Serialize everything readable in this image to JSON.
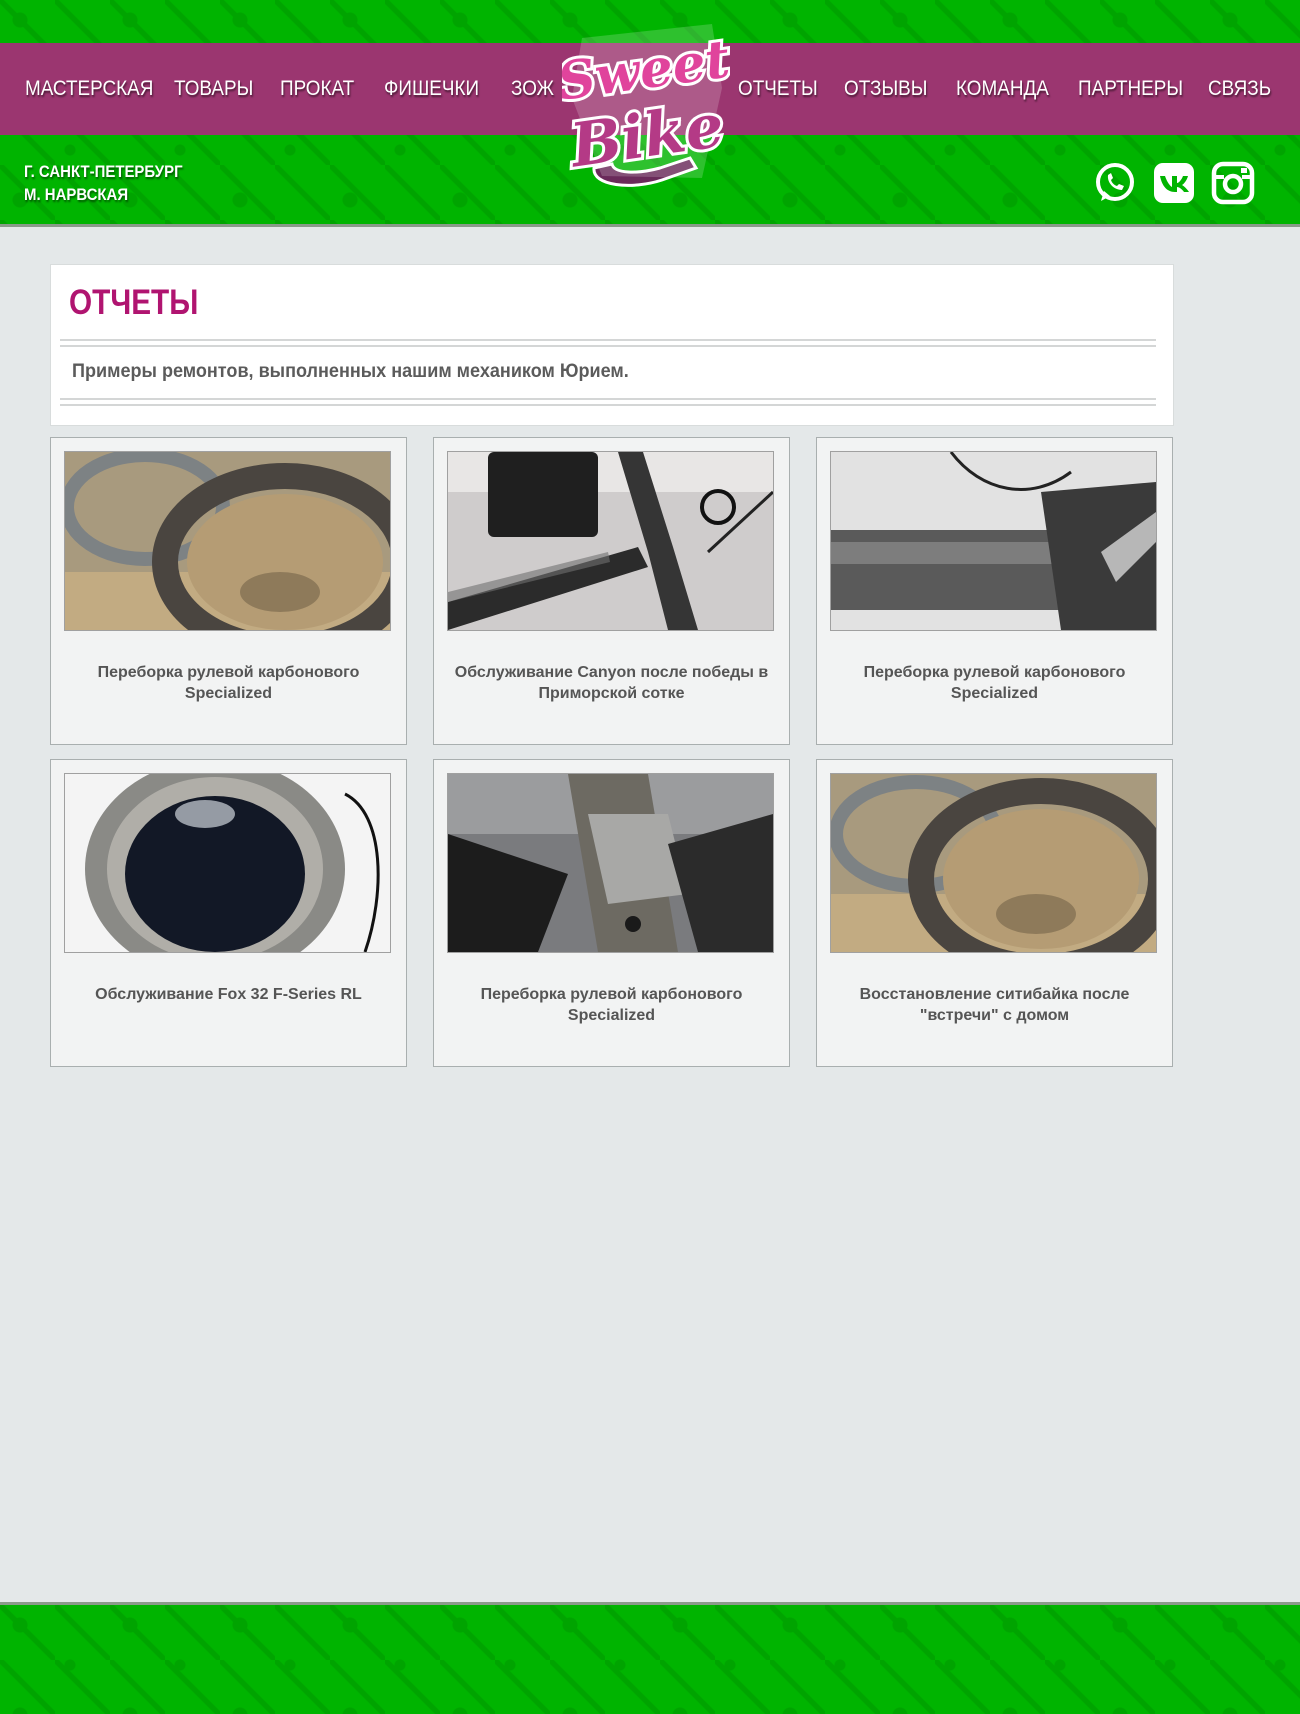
{
  "nav": {
    "left": [
      "МАСТЕРСКАЯ",
      "ТОВАРЫ",
      "ПРОКАТ",
      "ФИШЕЧКИ",
      "ЗОЖ"
    ],
    "right": [
      "ОТЧЕТЫ",
      "ОТЗЫВЫ",
      "КОМАНДА",
      "ПАРТНЕРЫ",
      "СВЯЗЬ"
    ]
  },
  "location": {
    "city": "Г. САНКТ-ПЕТЕРБУРГ",
    "metro": "М. НАРВСКАЯ"
  },
  "logo": {
    "text_line1": "Sweet",
    "text_line2": "Bike"
  },
  "social": [
    "whatsapp-icon",
    "vk-icon",
    "instagram-icon"
  ],
  "page": {
    "title": "ОТЧЕТЫ",
    "intro": "Примеры ремонтов, выполненных нашим механиком Юрием."
  },
  "reports": [
    {
      "caption": "Переборка рулевой карбонового Specialized"
    },
    {
      "caption": "Обслуживание Canyon после победы в Приморской сотке"
    },
    {
      "caption": "Переборка рулевой карбонового Specialized"
    },
    {
      "caption": "Обслуживание Fox 32 F-Series RL"
    },
    {
      "caption": "Переборка рулевой карбонового Specialized"
    },
    {
      "caption": "Восстановление ситибайка после \"встречи\" с домом"
    }
  ],
  "colors": {
    "header_green": "#00b400",
    "nav_purple": "#9b3670",
    "title_magenta": "#b01470",
    "page_bg": "#e4e8e9"
  }
}
